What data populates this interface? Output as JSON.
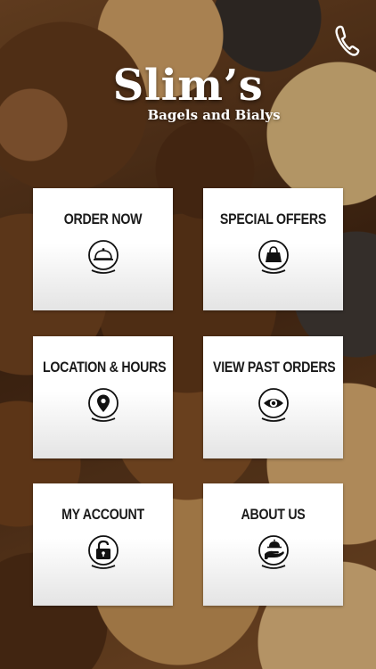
{
  "header": {
    "brand_name": "Slim’s",
    "brand_tagline": "Bagels and Bialys",
    "phone_icon": "phone-icon"
  },
  "menu": [
    {
      "label": "ORDER NOW",
      "icon": "cloche-icon"
    },
    {
      "label": "SPECIAL OFFERS",
      "icon": "shopping-bag-icon"
    },
    {
      "label": "LOCATION & HOURS",
      "icon": "map-pin-icon"
    },
    {
      "label": "VIEW PAST ORDERS",
      "icon": "eye-icon"
    },
    {
      "label": "MY ACCOUNT",
      "icon": "unlocked-padlock-icon"
    },
    {
      "label": "ABOUT US",
      "icon": "waiter-serving-icon"
    }
  ],
  "colors": {
    "tile_background": "#ffffff",
    "tile_text": "#1a1a1a",
    "brand_text": "#ffffff"
  }
}
